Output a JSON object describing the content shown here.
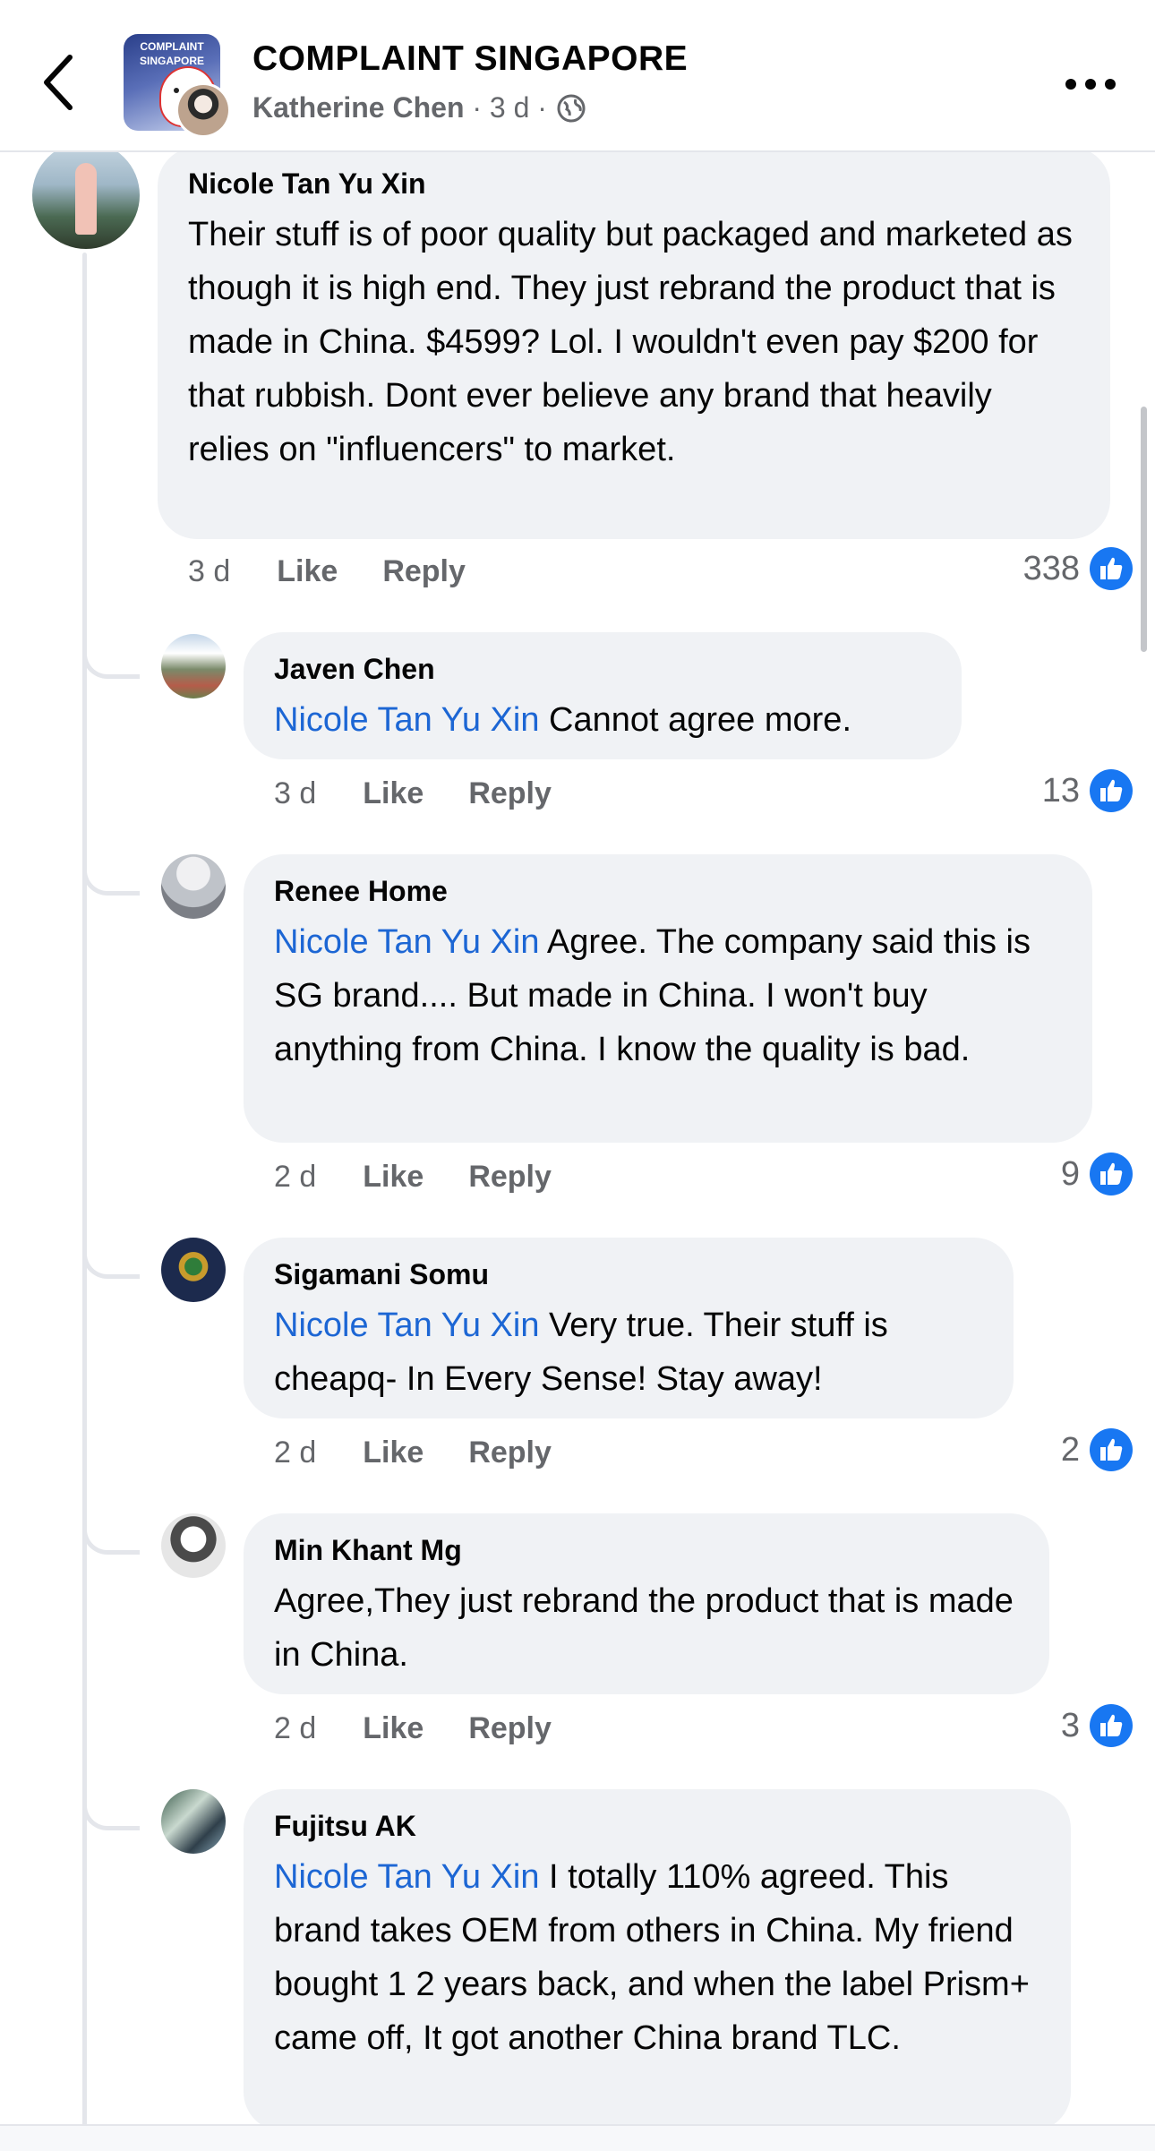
{
  "header": {
    "group_name": "COMPLAINT SINGAPORE",
    "author": "Katherine Chen",
    "separator1": "·",
    "time": "3 d",
    "separator2": "·",
    "group_avatar_text": "COMPLAINT SINGAPORE",
    "icons": [
      "back-arrow-icon",
      "globe-icon",
      "more-options-icon"
    ]
  },
  "comments": [
    {
      "name": "Nicole Tan Yu Xin",
      "mention": "",
      "text": "Their stuff is of poor quality but packaged and marketed as though it is high end. They just rebrand the product that is made in China. $4599? Lol. I wouldn't even pay $200 for that rubbish. Dont ever believe any brand that heavily relies on \"influencers\" to market.",
      "time": "3 d",
      "like_label": "Like",
      "reply_label": "Reply",
      "likes": "338"
    },
    {
      "name": "Javen Chen",
      "mention": "Nicole Tan Yu Xin",
      "text": " Cannot agree more.",
      "time": "3 d",
      "like_label": "Like",
      "reply_label": "Reply",
      "likes": "13"
    },
    {
      "name": "Renee Home",
      "mention": "Nicole Tan Yu Xin",
      "text": " Agree. The company said this is SG brand.... But made in China. I won't buy anything from China. I know the quality is bad.",
      "time": "2 d",
      "like_label": "Like",
      "reply_label": "Reply",
      "likes": "9"
    },
    {
      "name": "Sigamani Somu",
      "mention": "Nicole Tan Yu Xin",
      "text": " Very true. Their stuff is cheapq- In Every Sense! Stay away!",
      "time": "2 d",
      "like_label": "Like",
      "reply_label": "Reply",
      "likes": "2"
    },
    {
      "name": "Min Khant Mg",
      "mention": "",
      "text": "Agree,They just rebrand the product that is made in China.",
      "time": "2 d",
      "like_label": "Like",
      "reply_label": "Reply",
      "likes": "3"
    },
    {
      "name": "Fujitsu AK",
      "mention": "Nicole Tan Yu Xin",
      "text": " I totally 110% agreed. This brand takes OEM from others in China. My friend bought 1 2 years back, and when the label Prism+ came off, It got another China brand TLC.",
      "time": "",
      "like_label": "",
      "reply_label": "",
      "likes": ""
    }
  ],
  "colors": {
    "mention": "#1c66d4",
    "like_badge": "#1877f2",
    "bubble": "#f0f2f5",
    "secondary_text": "#65676b"
  }
}
